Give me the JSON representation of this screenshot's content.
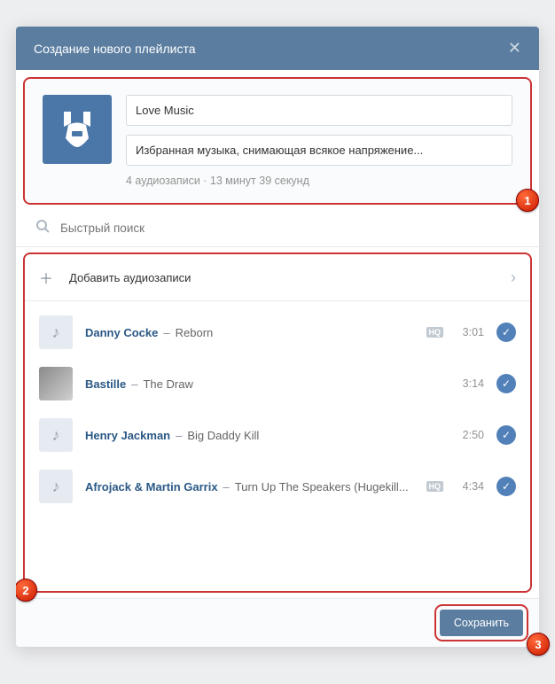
{
  "modal": {
    "title": "Создание нового плейлиста",
    "close_icon": "✕"
  },
  "form": {
    "name_value": "Love Music",
    "desc_value": "Избранная музыка, снимающая всякое напряжение...",
    "meta": "4 аудиозаписи   ·   13 минут 39 секунд"
  },
  "search": {
    "placeholder": "Быстрый поиск"
  },
  "add": {
    "label": "Добавить аудиозаписи"
  },
  "tracks": [
    {
      "artist": "Danny Cocke",
      "title": "Reborn",
      "duration": "3:01",
      "hq": true,
      "cover": "note"
    },
    {
      "artist": "Bastille",
      "title": "The Draw",
      "duration": "3:14",
      "hq": false,
      "cover": "img"
    },
    {
      "artist": "Henry Jackman",
      "title": "Big Daddy Kill",
      "duration": "2:50",
      "hq": false,
      "cover": "note"
    },
    {
      "artist": "Afrojack & Martin Garrix",
      "title": "Turn Up The Speakers (Hugekill...",
      "duration": "4:34",
      "hq": true,
      "cover": "note"
    }
  ],
  "footer": {
    "save": "Сохранить"
  },
  "annotations": {
    "one": "1",
    "two": "2",
    "three": "3"
  },
  "icons": {
    "hq": "HQ",
    "plus": "＋",
    "chevron": "›",
    "note": "♪",
    "check": "✓"
  }
}
